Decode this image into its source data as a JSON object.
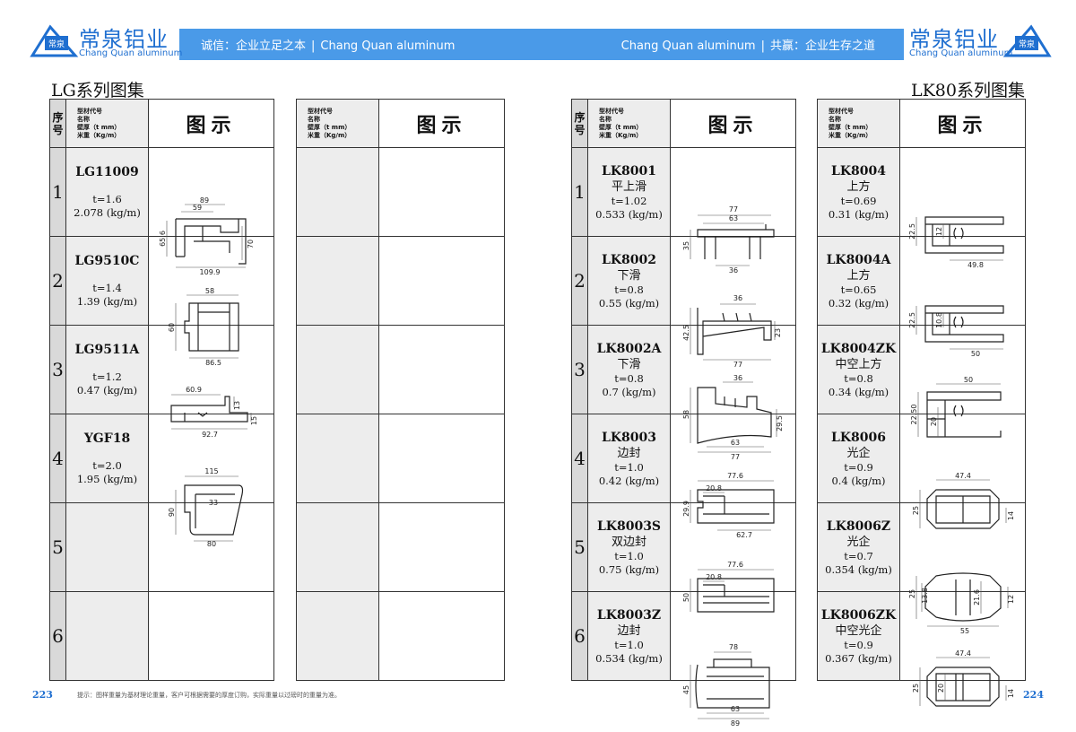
{
  "brand": {
    "name_cn": "常泉铝业",
    "name_en": "Chang Quan aluminum",
    "mark": "常泉"
  },
  "header": {
    "left_slogan": "诚信：企业立足之本",
    "left_en": "Chang Quan aluminum",
    "right_en": "Chang Quan aluminum",
    "right_slogan": "共赢：企业生存之道",
    "band_color": "#4a9ae8"
  },
  "titles": {
    "left": "LG系列图集",
    "right": "LK80系列图集"
  },
  "table_header": {
    "seq": "序号",
    "info_lines": [
      "型材代号",
      "名称",
      "壁厚（t mm）",
      "米重（Kg/m）"
    ],
    "figure": "图示"
  },
  "left_page": {
    "table1": [
      {
        "seq": "1",
        "code": "LG11009",
        "name": "",
        "thickness": "t=1.6",
        "weight": "2.078 (kg/m)",
        "dims": [
          "89",
          "59",
          "65.6",
          "70",
          "109.9"
        ]
      },
      {
        "seq": "2",
        "code": "LG9510C",
        "name": "",
        "thickness": "t=1.4",
        "weight": "1.39 (kg/m)",
        "dims": [
          "58",
          "60",
          "86.5"
        ]
      },
      {
        "seq": "3",
        "code": "LG9511A",
        "name": "",
        "thickness": "t=1.2",
        "weight": "0.47 (kg/m)",
        "dims": [
          "60.9",
          "13",
          "15",
          "92.7"
        ]
      },
      {
        "seq": "4",
        "code": "YGF18",
        "name": "",
        "thickness": "t=2.0",
        "weight": "1.95 (kg/m)",
        "dims": [
          "115",
          "33",
          "90",
          "80"
        ]
      },
      {
        "seq": "5",
        "code": "",
        "name": "",
        "thickness": "",
        "weight": "",
        "dims": []
      },
      {
        "seq": "6",
        "code": "",
        "name": "",
        "thickness": "",
        "weight": "",
        "dims": []
      }
    ]
  },
  "right_page": {
    "table1": [
      {
        "seq": "1",
        "code": "LK8001",
        "name": "平上滑",
        "thickness": "t=1.02",
        "weight": "0.533 (kg/m)",
        "dims": [
          "77",
          "63",
          "35",
          "36"
        ]
      },
      {
        "seq": "2",
        "code": "LK8002",
        "name": "下滑",
        "thickness": "t=0.8",
        "weight": "0.55 (kg/m)",
        "dims": [
          "36",
          "42.5",
          "23",
          "77"
        ]
      },
      {
        "seq": "3",
        "code": "LK8002A",
        "name": "下滑",
        "thickness": "t=0.8",
        "weight": "0.7 (kg/m)",
        "dims": [
          "36",
          "58",
          "29.5",
          "63",
          "77"
        ]
      },
      {
        "seq": "4",
        "code": "LK8003",
        "name": "边封",
        "thickness": "t=1.0",
        "weight": "0.42 (kg/m)",
        "dims": [
          "77.6",
          "20.8",
          "29.9",
          "62.7"
        ]
      },
      {
        "seq": "5",
        "code": "LK8003S",
        "name": "双边封",
        "thickness": "t=1.0",
        "weight": "0.75 (kg/m)",
        "dims": [
          "77.6",
          "20.8",
          "50"
        ]
      },
      {
        "seq": "6",
        "code": "LK8003Z",
        "name": "边封",
        "thickness": "t=1.0",
        "weight": "0.534 (kg/m)",
        "dims": [
          "78",
          "45",
          "63",
          "89"
        ]
      }
    ],
    "table2": [
      {
        "code": "LK8004",
        "name": "上方",
        "thickness": "t=0.69",
        "weight": "0.31 (kg/m)",
        "dims": [
          "22.5",
          "12",
          "49.8"
        ]
      },
      {
        "code": "LK8004A",
        "name": "上方",
        "thickness": "t=0.65",
        "weight": "0.32 (kg/m)",
        "dims": [
          "22.5",
          "10.8",
          "50"
        ]
      },
      {
        "code": "LK8004ZK",
        "name": "中空上方",
        "thickness": "t=0.8",
        "weight": "0.34 (kg/m)",
        "dims": [
          "50",
          "22.50",
          "20"
        ]
      },
      {
        "code": "LK8006",
        "name": "光企",
        "thickness": "t=0.9",
        "weight": "0.4 (kg/m)",
        "dims": [
          "47.4",
          "25",
          "14"
        ]
      },
      {
        "code": "LK8006Z",
        "name": "光企",
        "thickness": "t=0.7",
        "weight": "0.354 (kg/m)",
        "dims": [
          "25",
          "13.8",
          "21.6",
          "12",
          "55"
        ]
      },
      {
        "code": "LK8006ZK",
        "name": "中空光企",
        "thickness": "t=0.9",
        "weight": "0.367 (kg/m)",
        "dims": [
          "47.4",
          "25",
          "20",
          "14"
        ]
      }
    ]
  },
  "footer": {
    "page_left": "223",
    "page_right": "224",
    "note": "提示：图样重量为基材理论重量，客户可根据需要的厚度订购，实际重量以过磅时的重量为准。"
  }
}
